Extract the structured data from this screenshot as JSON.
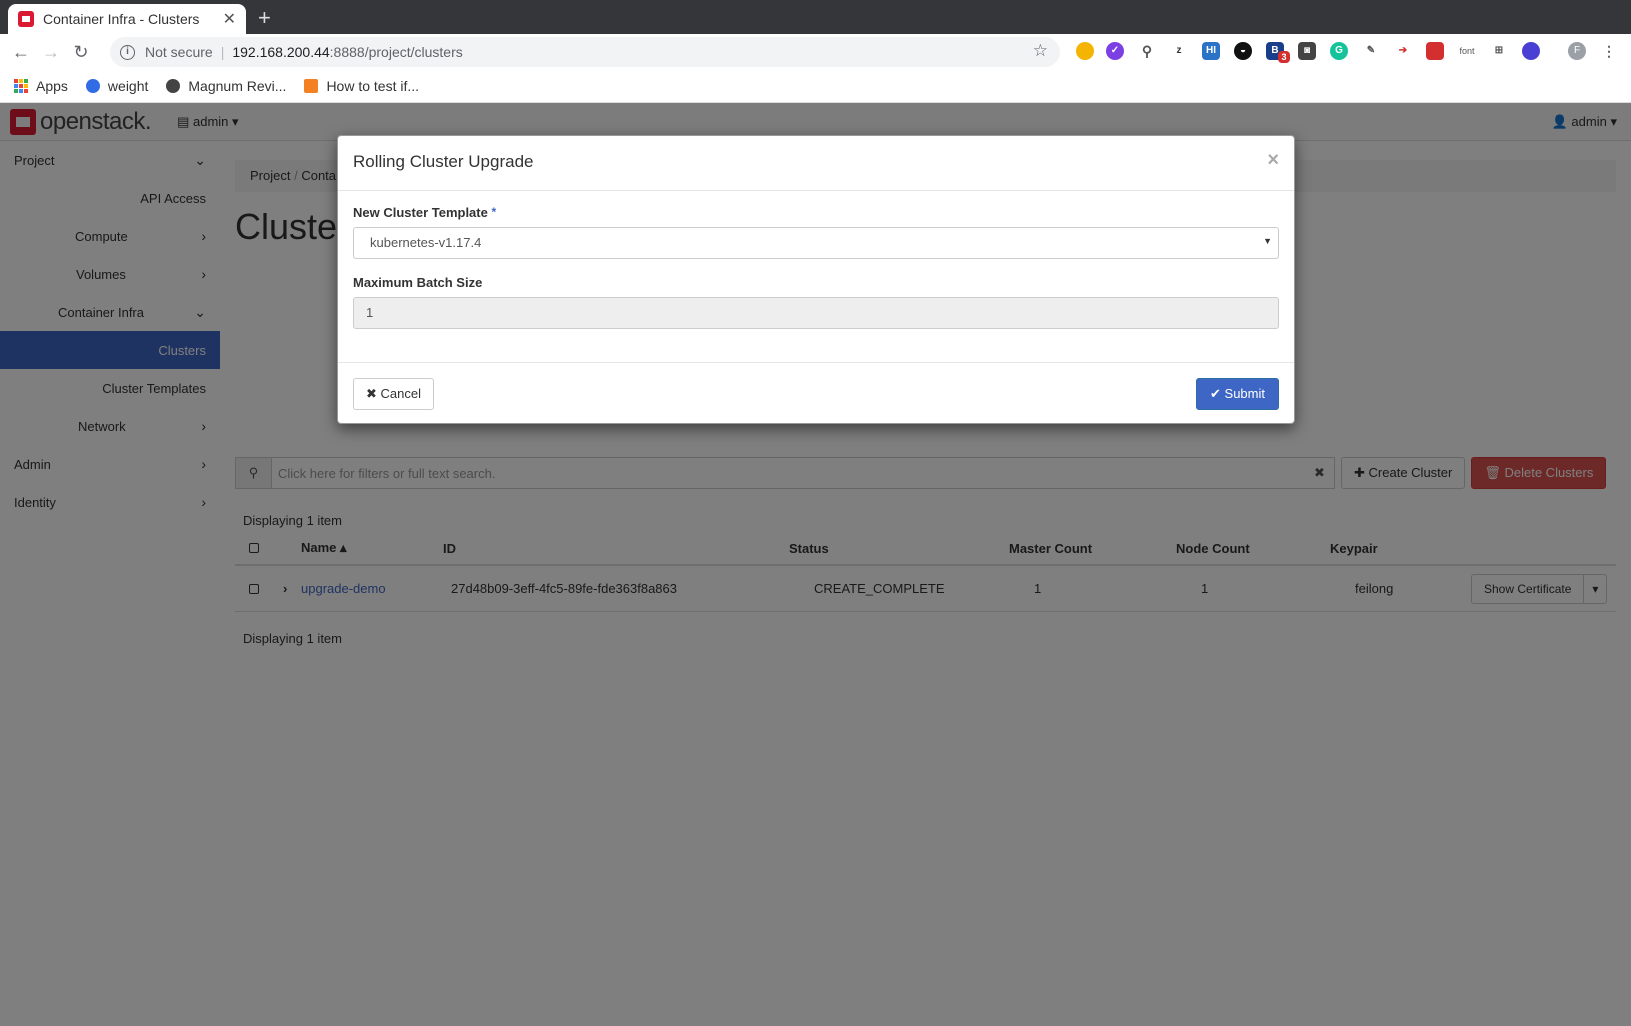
{
  "browser": {
    "tab_title": "Container Infra - Clusters",
    "not_secure": "Not secure",
    "url_host": "192.168.200.44",
    "url_rest": ":8888/project/clusters",
    "profile_initial": "F",
    "ext_badge": "3",
    "ext_font_label": "font",
    "bookmarks": [
      "Apps",
      "weight",
      "Magnum Revi...",
      "How to test if..."
    ]
  },
  "app": {
    "logo_text": "openstack.",
    "project_selector": "admin",
    "user_menu": "admin",
    "sidebar": [
      {
        "label": "Project",
        "level": 0,
        "chevron": "down"
      },
      {
        "label": "API Access",
        "level": 2,
        "chevron": ""
      },
      {
        "label": "Compute",
        "level": 1,
        "chevron": "right"
      },
      {
        "label": "Volumes",
        "level": 1,
        "chevron": "right"
      },
      {
        "label": "Container Infra",
        "level": 1,
        "chevron": "down"
      },
      {
        "label": "Clusters",
        "level": 2,
        "chevron": "",
        "active": true
      },
      {
        "label": "Cluster Templates",
        "level": 2,
        "chevron": ""
      },
      {
        "label": "Network",
        "level": 1,
        "chevron": "right"
      },
      {
        "label": "Admin",
        "level": 0,
        "chevron": "right"
      },
      {
        "label": "Identity",
        "level": 0,
        "chevron": "right"
      }
    ],
    "breadcrumb": [
      "Project",
      "Conta"
    ],
    "page_title": "Cluster",
    "search_placeholder": "Click here for filters or full text search.",
    "create_button": "Create Cluster",
    "delete_button": "Delete Clusters",
    "displaying": "Displaying 1 item",
    "table": {
      "headers": [
        "Name",
        "ID",
        "Status",
        "Master Count",
        "Node Count",
        "Keypair"
      ],
      "rows": [
        {
          "name": "upgrade-demo",
          "id": "27d48b09-3eff-4fc5-89fe-fde363f8a863",
          "status": "CREATE_COMPLETE",
          "master_count": "1",
          "node_count": "1",
          "keypair": "feilong",
          "action": "Show Certificate"
        }
      ]
    }
  },
  "modal": {
    "title": "Rolling Cluster Upgrade",
    "template_label": "New Cluster Template",
    "required_mark": "*",
    "template_value": "kubernetes-v1.17.4",
    "batch_label": "Maximum Batch Size",
    "batch_value": "1",
    "cancel": "Cancel",
    "submit": "Submit"
  },
  "colors": {
    "accent": "#3e66c4",
    "danger": "#d9534f",
    "brand": "#da1a32"
  }
}
